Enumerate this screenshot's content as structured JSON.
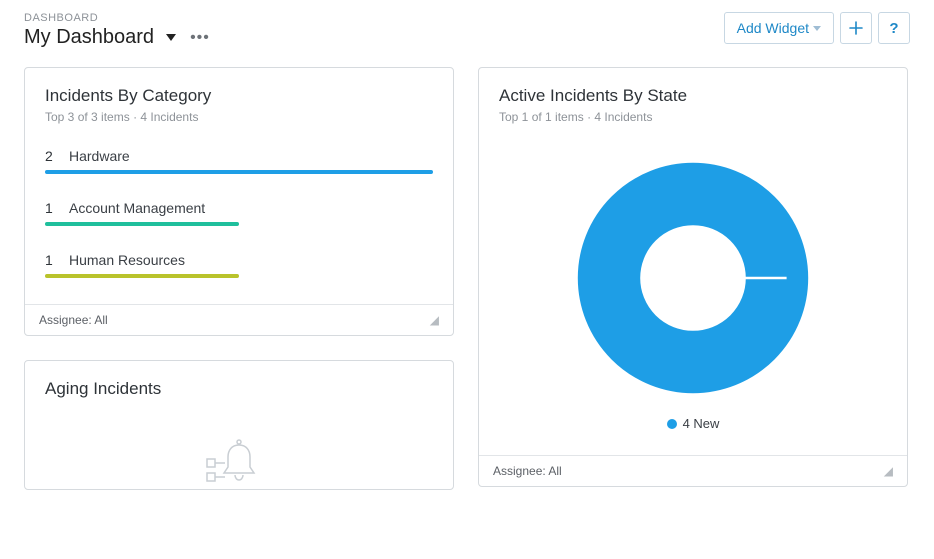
{
  "header": {
    "breadcrumb": "DASHBOARD",
    "title": "My Dashboard",
    "add_widget_label": "Add Widget",
    "help_label": "?"
  },
  "cards": {
    "incidents_by_category": {
      "title": "Incidents By Category",
      "subtitle_a": "Top 3 of 3 items",
      "subtitle_b": "4 Incidents",
      "footer_label": "Assignee: All"
    },
    "active_incidents_by_state": {
      "title": "Active Incidents By State",
      "subtitle_a": "Top 1 of 1 items",
      "subtitle_b": "4 Incidents",
      "legend_text": "4 New",
      "footer_label": "Assignee: All"
    },
    "aging_incidents": {
      "title": "Aging Incidents"
    }
  },
  "chart_data": [
    {
      "id": "incidents_by_category",
      "type": "bar",
      "orientation": "horizontal",
      "title": "Incidents By Category",
      "total": 4,
      "categories": [
        "Hardware",
        "Account Management",
        "Human Resources"
      ],
      "values": [
        2,
        1,
        1
      ],
      "colors": [
        "#1e9ee6",
        "#1fbf9c",
        "#b9c32b"
      ]
    },
    {
      "id": "active_incidents_by_state",
      "type": "pie",
      "title": "Active Incidents By State",
      "total": 4,
      "series": [
        {
          "name": "New",
          "value": 4,
          "color": "#1e9ee6"
        }
      ]
    }
  ]
}
